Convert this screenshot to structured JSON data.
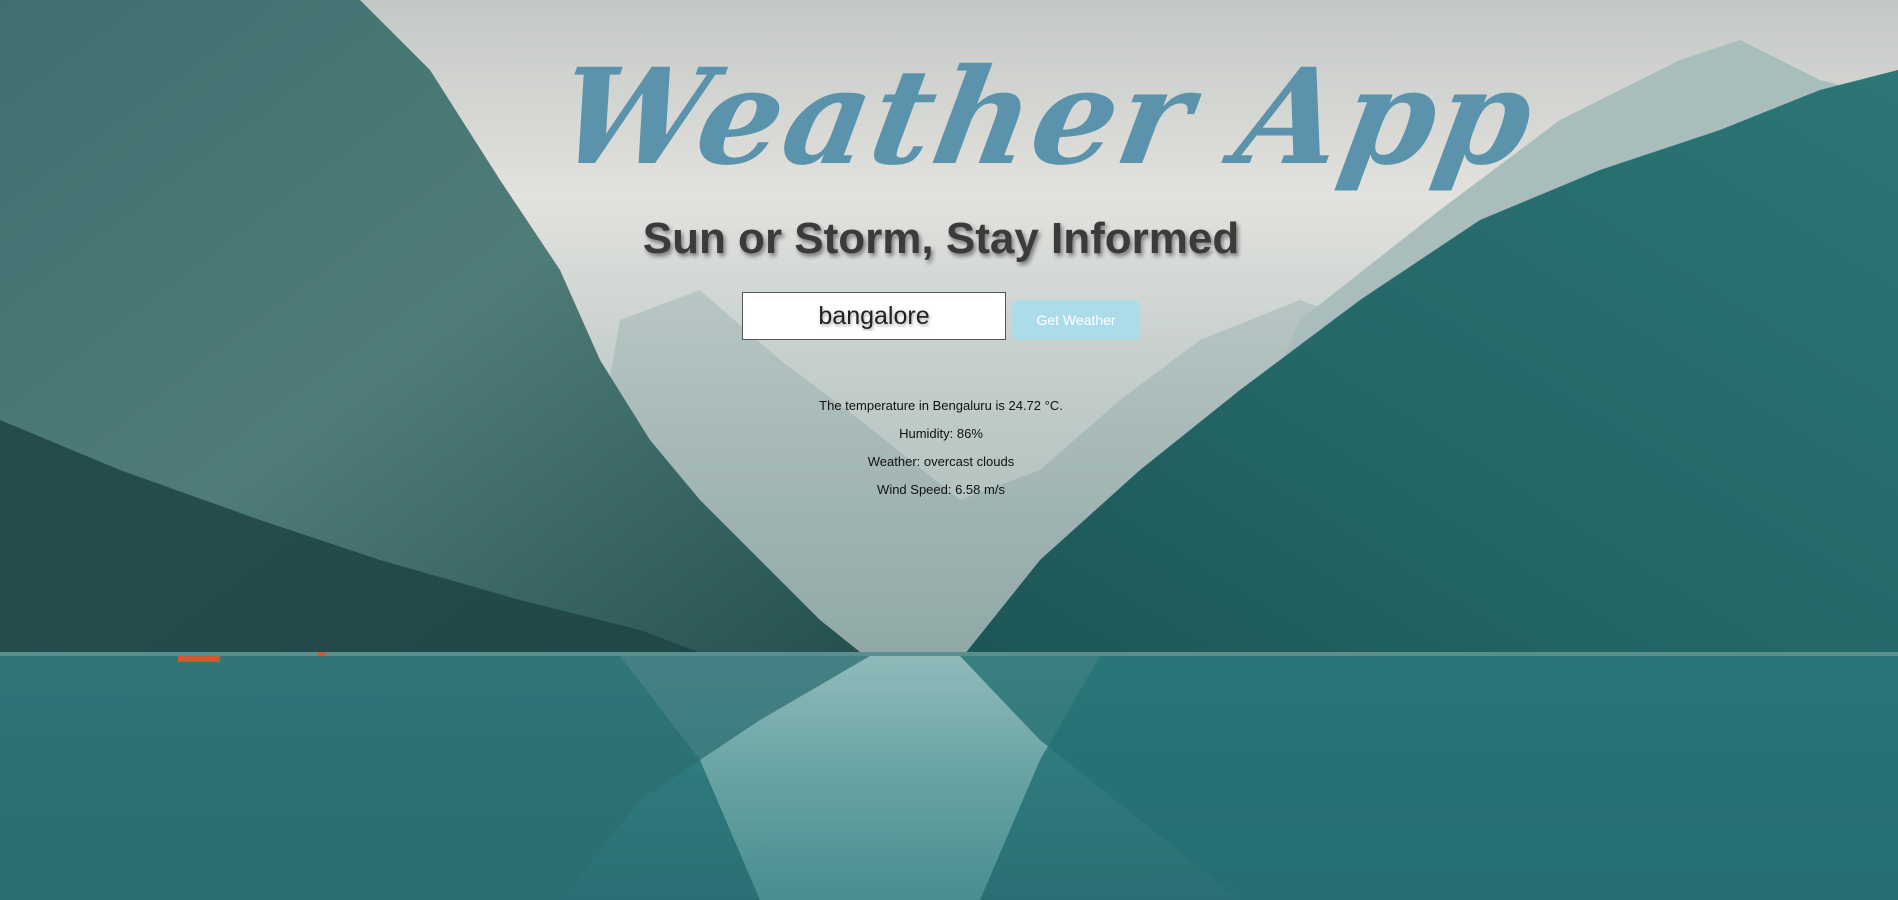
{
  "app": {
    "title": "Weather App",
    "tagline": "Sun or Storm, Stay Informed"
  },
  "search": {
    "value": "bangalore",
    "button_label": "Get Weather"
  },
  "results": {
    "temperature": "The temperature in Bengaluru is 24.72 °C.",
    "humidity": "Humidity: 86%",
    "weather": "Weather: overcast clouds",
    "wind": "Wind Speed: 6.58 m/s"
  },
  "colors": {
    "title": "#5b93ad",
    "tagline": "#3b3b3b",
    "button_bg": "#acdbe9",
    "button_text": "#ffffff",
    "lake": "#3f8c8f"
  }
}
